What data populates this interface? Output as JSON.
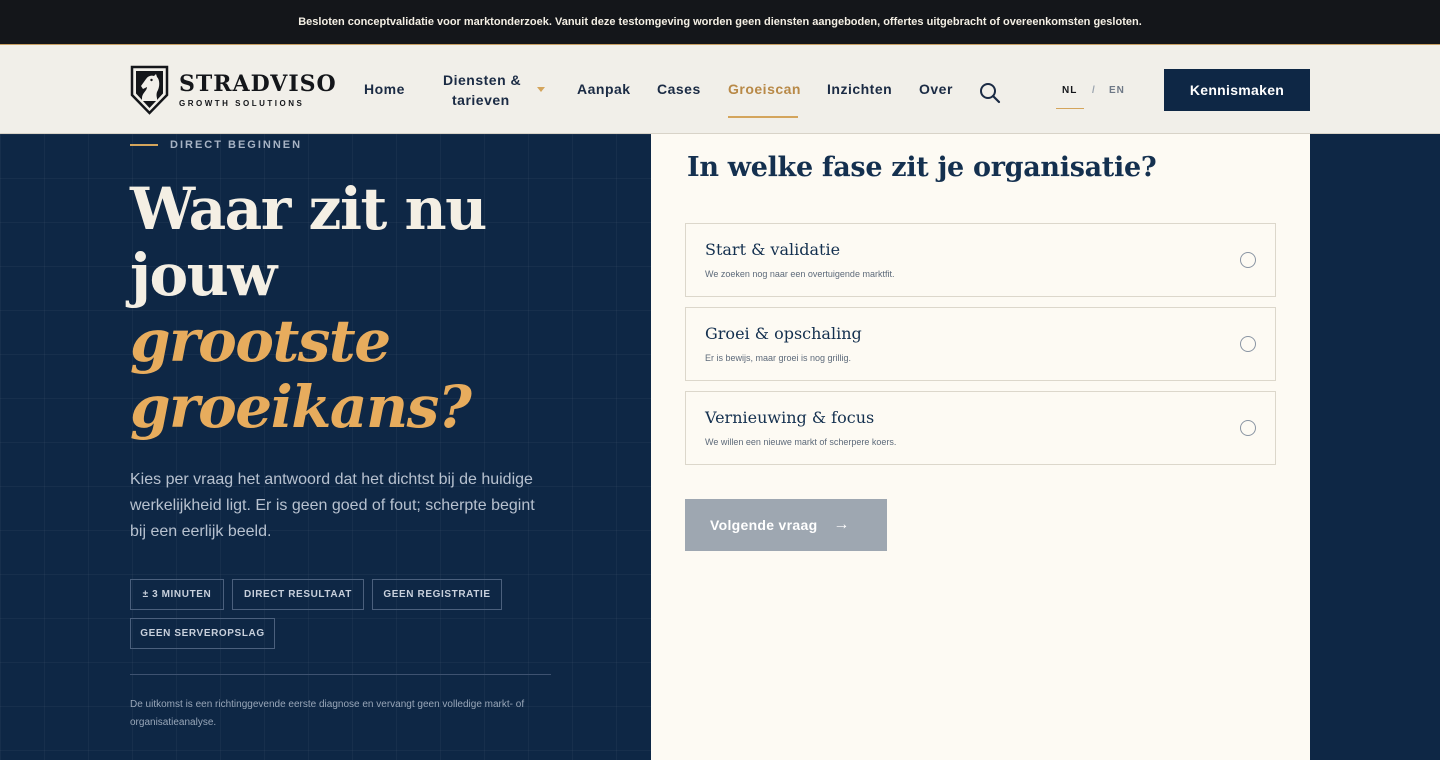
{
  "announcement": "Besloten conceptvalidatie voor marktonderzoek. Vanuit deze testomgeving worden geen diensten aangeboden, offertes uitgebracht of overeenkomsten gesloten.",
  "brand": {
    "name": "STRADVISO",
    "tagline": "GROWTH SOLUTIONS",
    "logo_icon": "knight-chess-shield-icon"
  },
  "nav": {
    "home": "Home",
    "diensten_line1": "Diensten &",
    "diensten_line2": "tarieven",
    "aanpak": "Aanpak",
    "cases": "Cases",
    "groeiscan": "Groeiscan",
    "inzichten": "Inzichten",
    "over": "Over",
    "active": "Groeiscan"
  },
  "language": {
    "nl": "NL",
    "separator": "/",
    "en": "EN",
    "active": "NL"
  },
  "cta_label": "Kennismaken",
  "hero": {
    "eyebrow": "DIRECT BEGINNEN",
    "headline_line1": "Waar zit nu",
    "headline_line2": "jouw",
    "headline_accent1": "grootste",
    "headline_accent2": "groeikans?",
    "intro": "Kies per vraag het antwoord dat het dichtst bij de huidige werkelijkheid ligt. Er is geen goed of fout; scherpte begint bij een eerlijk beeld.",
    "chips": [
      "± 3 MINUTEN",
      "DIRECT RESULTAAT",
      "GEEN REGISTRATIE",
      "GEEN SERVEROPSLAG"
    ],
    "disclaimer": "De uitkomst is een richtinggevende eerste diagnose en vervangt geen volledige markt- of organisatieanalyse."
  },
  "question": {
    "title": "In welke fase zit je organisatie?",
    "options": [
      {
        "title": "Start & validatie",
        "subtitle": "We zoeken nog naar een overtuigende marktfit.",
        "selected": false
      },
      {
        "title": "Groei & opschaling",
        "subtitle": "Er is bewijs, maar groei is nog grillig.",
        "selected": false
      },
      {
        "title": "Vernieuwing & focus",
        "subtitle": "We willen een nieuwe markt of scherpere koers.",
        "selected": false
      }
    ],
    "next_label": "Volgende vraag",
    "next_arrow": "→"
  },
  "colors": {
    "navy": "#0e2745",
    "gold": "#e7ac5d",
    "cream": "#fdfaf3",
    "disabled_button": "#9ea7b1"
  }
}
